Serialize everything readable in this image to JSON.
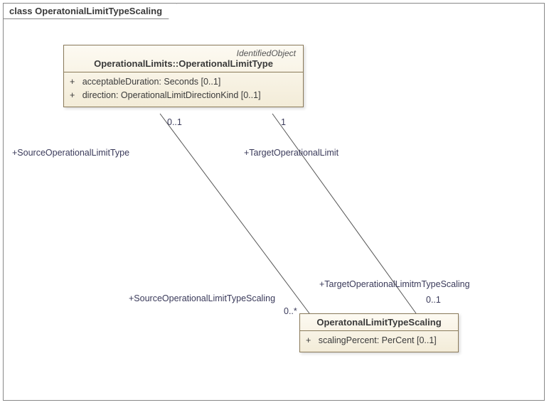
{
  "diagram": {
    "frame_label": "class OperatonialLimitTypeScaling"
  },
  "class1": {
    "stereotype": "IdentifiedObject",
    "name": "OperationalLimits::OperationalLimitType",
    "attrs": {
      "a0": "acceptableDuration: Seconds [0..1]",
      "a1": "direction: OperationalLimitDirectionKind [0..1]"
    }
  },
  "class2": {
    "name": "OperatonalLimitTypeScaling",
    "attrs": {
      "a0": "scalingPercent: PerCent [0..1]"
    }
  },
  "assoc_source": {
    "top_mult": "0..1",
    "top_role": "+SourceOperationalLimitType",
    "bottom_role": "+SourceOperationalLimitTypeScaling",
    "bottom_mult": "0..*"
  },
  "assoc_target": {
    "top_mult": "1",
    "top_role": "+TargetOperationalLimit",
    "bottom_role": "+TargetOperationalLimitmTypeScaling",
    "bottom_mult": "0..1"
  },
  "chart_data": {
    "type": "uml-class-diagram",
    "title": "class OperatonialLimitTypeScaling",
    "classes": [
      {
        "name": "OperationalLimits::OperationalLimitType",
        "stereotype": "IdentifiedObject",
        "attributes": [
          {
            "visibility": "+",
            "name": "acceptableDuration",
            "type": "Seconds",
            "multiplicity": "[0..1]"
          },
          {
            "visibility": "+",
            "name": "direction",
            "type": "OperationalLimitDirectionKind",
            "multiplicity": "[0..1]"
          }
        ]
      },
      {
        "name": "OperatonalLimitTypeScaling",
        "attributes": [
          {
            "visibility": "+",
            "name": "scalingPercent",
            "type": "PerCent",
            "multiplicity": "[0..1]"
          }
        ]
      }
    ],
    "associations": [
      {
        "end1": {
          "class": "OperationalLimits::OperationalLimitType",
          "role": "+SourceOperationalLimitType",
          "multiplicity": "0..1"
        },
        "end2": {
          "class": "OperatonalLimitTypeScaling",
          "role": "+SourceOperationalLimitTypeScaling",
          "multiplicity": "0..*"
        }
      },
      {
        "end1": {
          "class": "OperationalLimits::OperationalLimitType",
          "role": "+TargetOperationalLimit",
          "multiplicity": "1"
        },
        "end2": {
          "class": "OperatonalLimitTypeScaling",
          "role": "+TargetOperationalLimitmTypeScaling",
          "multiplicity": "0..1"
        }
      }
    ]
  }
}
